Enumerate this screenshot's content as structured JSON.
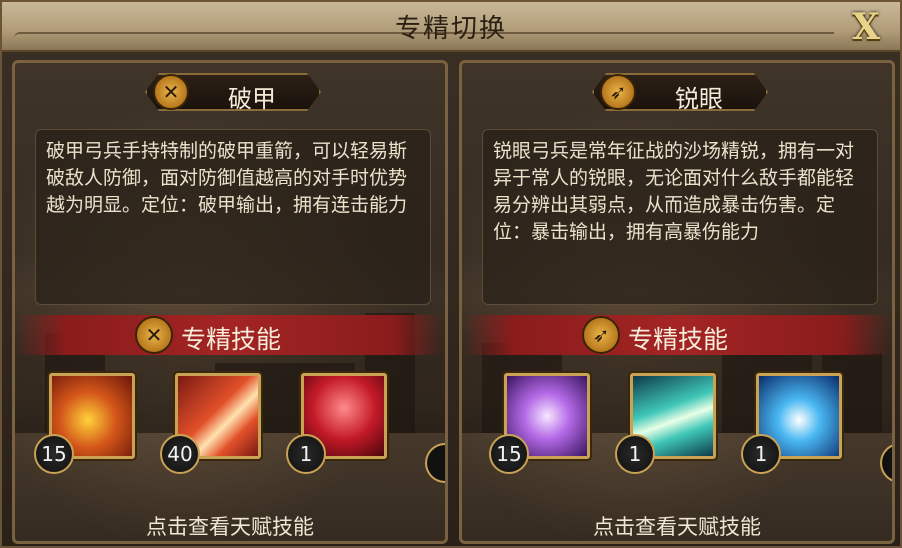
{
  "window": {
    "title": "专精切换",
    "close_label": "X"
  },
  "panels": [
    {
      "spec_name": "破甲",
      "emblem_icon": "crossed-arrows-icon",
      "description": "破甲弓兵手持特制的破甲重箭，可以轻易斯破敌人防御，面对防御值越高的对手时优势越为明显。定位：破甲输出，拥有连击能力",
      "skills_label": "专精技能",
      "skills": [
        {
          "icon": "shattering-blast-icon",
          "level": "15",
          "colors": [
            "#ffd23a",
            "#d4561a",
            "#6a1608"
          ]
        },
        {
          "icon": "flaming-arrows-icon",
          "level": "40",
          "colors": [
            "#ffe2b0",
            "#e2502a",
            "#7a1a12"
          ]
        },
        {
          "icon": "piercing-heart-icon",
          "level": "1",
          "colors": [
            "#ff8a8a",
            "#c41a28",
            "#4a060c"
          ]
        }
      ],
      "footer": "点击查看天赋技能"
    },
    {
      "spec_name": "锐眼",
      "emblem_icon": "bow-arrow-icon",
      "description": "锐眼弓兵是常年征战的沙场精锐，拥有一对异于常人的锐眼，无论面对什么敌手都能轻易分辨出其弱点，从而造成暴击伤害。定位：暴击输出，拥有高暴伤能力",
      "skills_label": "专精技能",
      "skills": [
        {
          "icon": "glowing-eye-icon",
          "level": "15",
          "colors": [
            "#f6e6ff",
            "#b46ae6",
            "#3a1460"
          ]
        },
        {
          "icon": "swift-arrow-icon",
          "level": "1",
          "colors": [
            "#e8ffe6",
            "#3fc7b8",
            "#0e3a4a"
          ]
        },
        {
          "icon": "energy-burst-icon",
          "level": "1",
          "colors": [
            "#ffffff",
            "#4ab8f2",
            "#0a2a6a"
          ]
        }
      ],
      "footer": "点击查看天赋技能"
    }
  ]
}
